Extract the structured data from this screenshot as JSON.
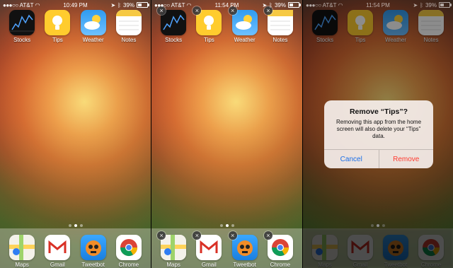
{
  "screens": [
    {
      "status": {
        "carrier": "AT&T",
        "time": "10:49 PM",
        "battery": "39%"
      },
      "top_apps": [
        {
          "name": "Stocks"
        },
        {
          "name": "Tips"
        },
        {
          "name": "Weather"
        },
        {
          "name": "Notes"
        }
      ],
      "dock_apps": [
        {
          "name": "Maps"
        },
        {
          "name": "Gmail"
        },
        {
          "name": "Tweetbot"
        },
        {
          "name": "Chrome"
        }
      ]
    },
    {
      "status": {
        "carrier": "AT&T",
        "time": "11:54 PM",
        "battery": "39%"
      },
      "top_apps": [
        {
          "name": "Stocks"
        },
        {
          "name": "Tips"
        },
        {
          "name": "Weather"
        },
        {
          "name": "Notes"
        }
      ],
      "dock_apps": [
        {
          "name": "Maps"
        },
        {
          "name": "Gmail"
        },
        {
          "name": "Tweetbot"
        },
        {
          "name": "Chrome"
        }
      ]
    },
    {
      "status": {
        "carrier": "AT&T",
        "time": "11:54 PM",
        "battery": "39%"
      },
      "top_apps": [
        {
          "name": "Stocks"
        },
        {
          "name": "Tips"
        },
        {
          "name": "Weather"
        },
        {
          "name": "Notes"
        }
      ],
      "dock_apps": [
        {
          "name": "Maps"
        },
        {
          "name": "Gmail"
        },
        {
          "name": "Tweetbot"
        },
        {
          "name": "Chrome"
        }
      ],
      "alert": {
        "title": "Remove “Tips”?",
        "message": "Removing this app from the home screen will also delete your “Tips” data.",
        "cancel": "Cancel",
        "remove": "Remove"
      }
    }
  ],
  "colors": {
    "cancel": "#1a6fe8",
    "remove": "#ff3b30",
    "tips": "#ffcc2e"
  },
  "battery_level": 0.39,
  "icons": [
    "stocks-icon",
    "tips-icon",
    "weather-icon",
    "notes-icon",
    "maps-icon",
    "gmail-icon",
    "tweetbot-icon",
    "chrome-icon",
    "delete-x-icon"
  ]
}
